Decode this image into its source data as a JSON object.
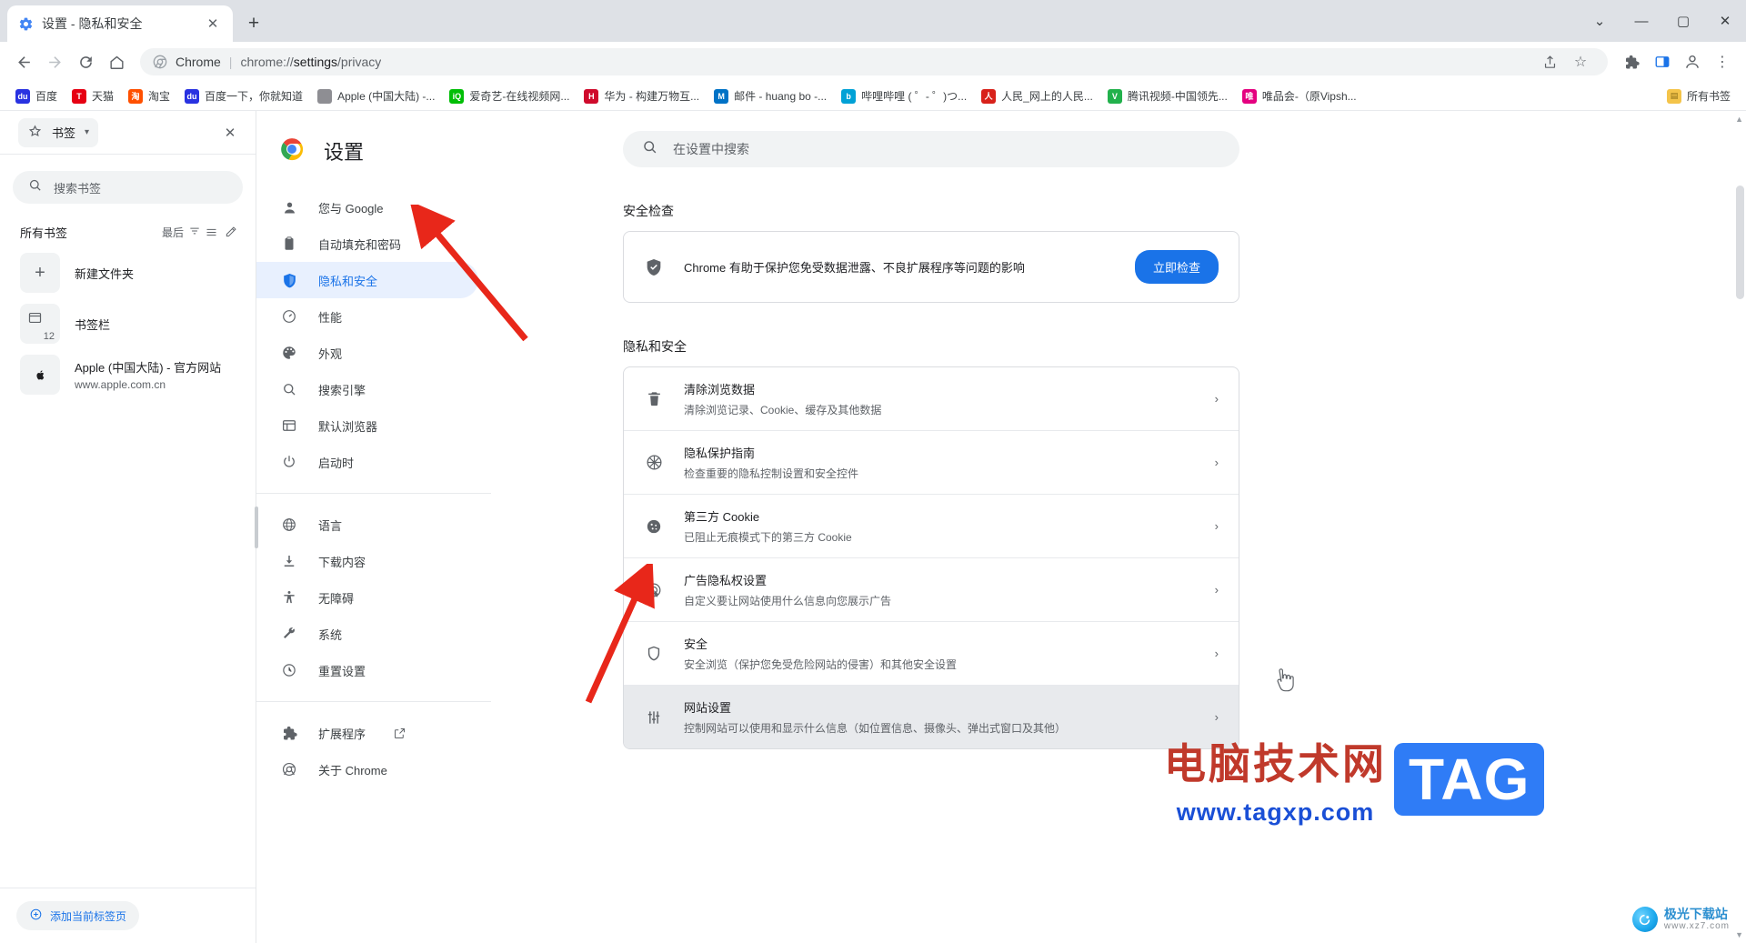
{
  "window": {
    "tab": {
      "title": "设置 - 隐私和安全",
      "favicon": "gear-icon",
      "close": "✕"
    },
    "new_tab_label": "+",
    "controls": {
      "minimize_all": "⌄",
      "minimize": "—",
      "maximize": "▢",
      "close": "✕"
    }
  },
  "toolbar": {
    "back": "←",
    "forward": "→",
    "reload": "⟳",
    "home": "⌂",
    "omnibox": {
      "brand": "Chrome",
      "separator": "|",
      "url_prefix": "chrome://",
      "url_bold": "settings",
      "url_suffix": "/privacy",
      "full_url": "chrome://settings/privacy"
    },
    "share": "share-icon",
    "bookmark_star": "☆",
    "extensions": "🧩",
    "sidepanel": "sidepanel-icon",
    "profile": "avatar-icon",
    "menu": "⋮"
  },
  "bookmarks_bar": {
    "items": [
      {
        "label": "百度",
        "icon_text": "du",
        "color": "#2932e1"
      },
      {
        "label": "天猫",
        "icon_text": "T",
        "color": "#e60012"
      },
      {
        "label": "淘宝",
        "icon_text": "淘",
        "color": "#ff5000"
      },
      {
        "label": "百度一下，你就知道",
        "icon_text": "du",
        "color": "#2932e1"
      },
      {
        "label": "Apple (中国大陆) -...",
        "icon_text": "",
        "color": "#8e8e93"
      },
      {
        "label": "爱奇艺-在线视频网...",
        "icon_text": "iQ",
        "color": "#00be06"
      },
      {
        "label": "华为 - 构建万物互...",
        "icon_text": "H",
        "color": "#cf0a2c"
      },
      {
        "label": "邮件 - huang bo -...",
        "icon_text": "M",
        "color": "#0072c6"
      },
      {
        "label": "哔哩哔哩 ( ゜- ゜)つ...",
        "icon_text": "b",
        "color": "#00a1d6"
      },
      {
        "label": "人民_网上的人民...",
        "icon_text": "人",
        "color": "#d8211a"
      },
      {
        "label": "腾讯视频-中国领先...",
        "icon_text": "V",
        "color": "#22b14c"
      },
      {
        "label": "唯品会-（原Vipsh...",
        "icon_text": "唯",
        "color": "#e4007f"
      }
    ],
    "all_bookmarks": "所有书签",
    "all_bookmarks_icon": "folder-icon"
  },
  "side_panel": {
    "combo_label": "书签",
    "star_icon": "star-icon",
    "chevron": "▾",
    "close": "✕",
    "search_placeholder": "搜索书签",
    "list_header": "所有书签",
    "sort_label": "最后",
    "filter_icon": "filter-icon",
    "view_icon": "list-view-icon",
    "edit_icon": "pencil-icon",
    "rows": [
      {
        "type": "new-folder",
        "title": "新建文件夹",
        "icon": "plus-icon",
        "sub": "",
        "count": ""
      },
      {
        "type": "folder",
        "title": "书签栏",
        "icon": "folder-icon",
        "sub": "",
        "count": "12"
      },
      {
        "type": "bookmark",
        "title": "Apple (中国大陆) - 官方网站",
        "icon": "apple-icon",
        "sub": "www.apple.com.cn",
        "count": ""
      }
    ],
    "footer_button": "添加当前标签页",
    "footer_icon": "plus-circle-icon"
  },
  "settings_nav": {
    "brand": "设置",
    "brand_icon": "chrome-logo-icon",
    "items": [
      {
        "label": "您与 Google",
        "icon": "person-icon",
        "active": false
      },
      {
        "label": "自动填充和密码",
        "icon": "clipboard-icon",
        "active": false
      },
      {
        "label": "隐私和安全",
        "icon": "shield-icon",
        "active": true
      },
      {
        "label": "性能",
        "icon": "gauge-icon",
        "active": false
      },
      {
        "label": "外观",
        "icon": "palette-icon",
        "active": false
      },
      {
        "label": "搜索引擎",
        "icon": "search-icon",
        "active": false
      },
      {
        "label": "默认浏览器",
        "icon": "browser-window-icon",
        "active": false
      },
      {
        "label": "启动时",
        "icon": "power-icon",
        "active": false
      }
    ],
    "items2": [
      {
        "label": "语言",
        "icon": "globe-icon",
        "active": false
      },
      {
        "label": "下载内容",
        "icon": "download-icon",
        "active": false
      },
      {
        "label": "无障碍",
        "icon": "accessibility-icon",
        "active": false
      },
      {
        "label": "系统",
        "icon": "wrench-icon",
        "active": false
      },
      {
        "label": "重置设置",
        "icon": "history-icon",
        "active": false
      }
    ],
    "items3": [
      {
        "label": "扩展程序",
        "icon": "puzzle-icon",
        "external": "external-link-icon",
        "active": false
      },
      {
        "label": "关于 Chrome",
        "icon": "chrome-outline-icon",
        "external": "",
        "active": false
      }
    ]
  },
  "main": {
    "search_placeholder": "在设置中搜索",
    "search_icon": "search-icon",
    "safety_check": {
      "heading": "安全检查",
      "icon": "shield-check-icon",
      "text": "Chrome 有助于保护您免受数据泄露、不良扩展程序等问题的影响",
      "button": "立即检查"
    },
    "privacy": {
      "heading": "隐私和安全",
      "rows": [
        {
          "icon": "trash-icon",
          "title": "清除浏览数据",
          "sub": "清除浏览记录、Cookie、缓存及其他数据",
          "arrow": "›",
          "highlight": false
        },
        {
          "icon": "privacy-guide-icon",
          "title": "隐私保护指南",
          "sub": "检查重要的隐私控制设置和安全控件",
          "arrow": "›",
          "highlight": false
        },
        {
          "icon": "cookie-icon",
          "title": "第三方 Cookie",
          "sub": "已阻止无痕模式下的第三方 Cookie",
          "arrow": "›",
          "highlight": false
        },
        {
          "icon": "ad-privacy-icon",
          "title": "广告隐私权设置",
          "sub": "自定义要让网站使用什么信息向您展示广告",
          "arrow": "›",
          "highlight": false
        },
        {
          "icon": "shield-icon",
          "title": "安全",
          "sub": "安全浏览（保护您免受危险网站的侵害）和其他安全设置",
          "arrow": "›",
          "highlight": false
        },
        {
          "icon": "sliders-icon",
          "title": "网站设置",
          "sub": "控制网站可以使用和显示什么信息（如位置信息、摄像头、弹出式窗口及其他）",
          "arrow": "›",
          "highlight": true
        }
      ]
    }
  },
  "watermark": {
    "cn_text": "电脑技术网",
    "url_text": "www.tagxp.com",
    "tag_text": "TAG",
    "corner_main": "极光下载站",
    "corner_sub": "www.xz7.com"
  },
  "colors": {
    "accent": "#1a73e8",
    "active_nav_bg": "#e8f0fe",
    "highlight_row": "#e8eaed",
    "arrow_red": "#e8271a",
    "watermark_red": "#c0392b",
    "watermark_blue": "#1a4fd6",
    "tag_blue": "#2f7cf6"
  }
}
